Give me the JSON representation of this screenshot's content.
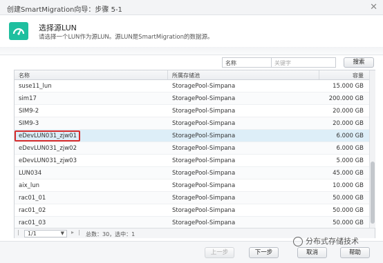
{
  "window": {
    "title": "创建SmartMigration向导：步骤 5-1"
  },
  "header": {
    "title": "选择源LUN",
    "description": "请选择一个LUN作为源LUN。源LUN是SmartMigration的数据源。"
  },
  "search": {
    "field_value": "名称",
    "keyword_placeholder": "关键字",
    "button_label": "搜索"
  },
  "table": {
    "columns": [
      "名称",
      "所属存储池",
      "容量"
    ],
    "rows": [
      {
        "name": "suse11_lun",
        "pool": "StoragePool-Simpana",
        "capacity": "15.000 GB"
      },
      {
        "name": "sim17",
        "pool": "StoragePool-Simpana",
        "capacity": "200.000 GB"
      },
      {
        "name": "SIM9-2",
        "pool": "StoragePool-Simpana",
        "capacity": "20.000 GB"
      },
      {
        "name": "SIM9-3",
        "pool": "StoragePool-Simpana",
        "capacity": "20.000 GB"
      },
      {
        "name": "eDevLUN031_zjw01",
        "pool": "StoragePool-Simpana",
        "capacity": "6.000 GB"
      },
      {
        "name": "eDevLUN031_zjw02",
        "pool": "StoragePool-Simpana",
        "capacity": "6.000 GB"
      },
      {
        "name": "eDevLUN031_zjw03",
        "pool": "StoragePool-Simpana",
        "capacity": "5.000 GB"
      },
      {
        "name": "LUN034",
        "pool": "StoragePool-Simpana",
        "capacity": "45.000 GB"
      },
      {
        "name": "aix_lun",
        "pool": "StoragePool-Simpana",
        "capacity": "10.000 GB"
      },
      {
        "name": "rac01_01",
        "pool": "StoragePool-Simpana",
        "capacity": "50.000 GB"
      },
      {
        "name": "rac01_02",
        "pool": "StoragePool-Simpana",
        "capacity": "50.000 GB"
      },
      {
        "name": "rac01_03",
        "pool": "StoragePool-Simpana",
        "capacity": "50.000 GB"
      }
    ],
    "selected_row": 4
  },
  "pagination": {
    "page": "1/1",
    "summary": "总数：30，选中：1"
  },
  "footer": {
    "prev_label": "上一步",
    "next_label": "下一步",
    "cancel_label": "取消",
    "help_label": "帮助"
  },
  "watermark": {
    "text": "分布式存储技术"
  },
  "colors": {
    "accent": "#1fbf9f",
    "selection": "#ddeef8",
    "highlight_border": "#d62b2b"
  },
  "icons": {
    "logo": "migration-gauge-icon",
    "close": "close-icon",
    "collapse": "double-chevron-icon"
  }
}
